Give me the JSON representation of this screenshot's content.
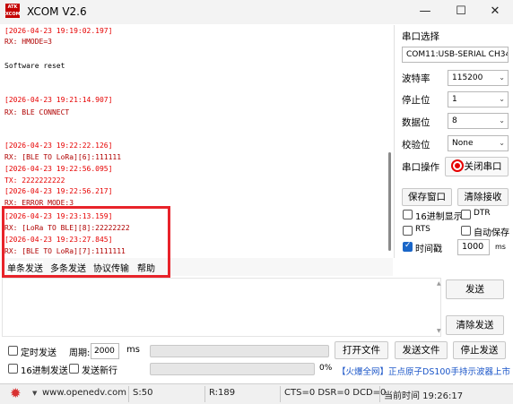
{
  "window": {
    "title": "XCOM V2.6",
    "icon_text": "ATK\nXCOM",
    "minimize": "—",
    "maximize": "☐",
    "close": "✕"
  },
  "receive": {
    "lines": [
      {
        "text": "[2026-04-23 19:19:02.197]",
        "kind": "ts"
      },
      {
        "text": "RX: HMODE=3",
        "kind": "rx"
      },
      {
        "text": "Software reset",
        "kind": "plain"
      },
      {
        "text": "[2026-04-23 19:21:14.907]",
        "kind": "ts"
      },
      {
        "text": "RX: BLE CONNECT",
        "kind": "rx"
      },
      {
        "text": "[2026-04-23 19:22:22.126]",
        "kind": "ts"
      },
      {
        "text": "RX: [BLE TO LoRa][6]:111111",
        "kind": "rx"
      },
      {
        "text": "[2026-04-23 19:22:56.095]",
        "kind": "ts"
      },
      {
        "text": "TX: 2222222222",
        "kind": "ts"
      },
      {
        "text": "[2026-04-23 19:22:56.217]",
        "kind": "ts"
      },
      {
        "text": "RX: ERROR MODE:3",
        "kind": "rx"
      },
      {
        "text": "[2026-04-23 19:23:13.159]",
        "kind": "ts"
      },
      {
        "text": "RX: [LoRa TO BLE][8]:22222222",
        "kind": "rx"
      },
      {
        "text": "[2026-04-23 19:23:27.845]",
        "kind": "ts"
      },
      {
        "text": "RX: [BLE TO LoRa][7]:1111111",
        "kind": "rx"
      }
    ]
  },
  "tabs": [
    "单条发送",
    "多条发送",
    "协议传输",
    "帮助"
  ],
  "panel": {
    "port_select_label": "串口选择",
    "port_value": "COM11:USB-SERIAL CH34",
    "baud_label": "波特率",
    "baud_value": "115200",
    "stopbits_label": "停止位",
    "stopbits_value": "1",
    "databits_label": "数据位",
    "databits_value": "8",
    "parity_label": "校验位",
    "parity_value": "None",
    "port_op_label": "串口操作",
    "close_port_label": "关闭串口",
    "save_window_label": "保存窗口",
    "clear_recv_label": "清除接收",
    "hex_display_label": "16进制显示",
    "dtr_label": "DTR",
    "rts_label": "RTS",
    "auto_save_label": "自动保存",
    "timestamp_label": "时间戳",
    "timestamp_value": "1000",
    "timestamp_unit": "ms",
    "hex_display_checked": false,
    "dtr_checked": false,
    "rts_checked": false,
    "auto_save_checked": false,
    "timestamp_checked": true
  },
  "send": {
    "send_label": "发送",
    "clear_send_label": "清除发送"
  },
  "bottom": {
    "timed_send_label": "定时发送",
    "period_label": "周期:",
    "period_value": "2000",
    "period_unit": "ms",
    "open_file_label": "打开文件",
    "send_file_label": "发送文件",
    "stop_send_label": "停止发送",
    "hex_send_label": "16进制发送",
    "send_newline_label": "发送新行",
    "progress_text": "0%",
    "progress_value": 0,
    "ad_text": "【火爆全网】正点原子DS100手持示波器上市",
    "timed_send_checked": false,
    "hex_send_checked": false,
    "send_newline_checked": false
  },
  "status": {
    "url": "www.openedv.com",
    "sent": "S:50",
    "received": "R:189",
    "signals": "CTS=0 DSR=0 DCD=0",
    "time": "当前时间 19:26:17"
  },
  "colors": {
    "timestamp": "#e60000",
    "rx": "#b00000",
    "highlight": "#e8232a",
    "checked": "#1a66c8",
    "link": "#1a55c8"
  }
}
